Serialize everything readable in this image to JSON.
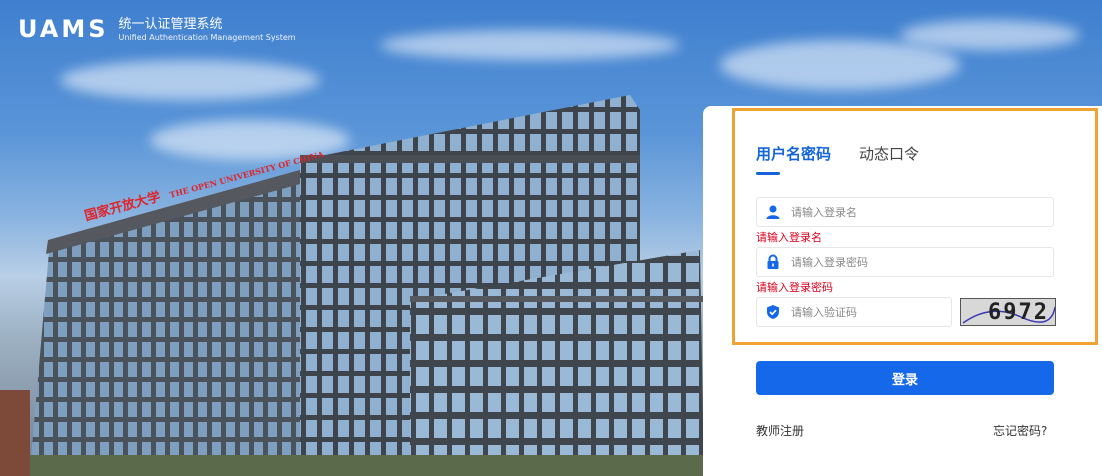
{
  "header": {
    "logo_main": "UAMS",
    "logo_cn": "统一认证管理系统",
    "logo_en": "Unified Authentication Management System"
  },
  "background": {
    "building_sign_cn": "国家开放大学",
    "building_sign_en": "THE OPEN UNIVERSITY OF CHINA"
  },
  "tabs": [
    {
      "label": "用户名密码",
      "active": true
    },
    {
      "label": "动态口令",
      "active": false
    }
  ],
  "form": {
    "username": {
      "placeholder": "请输入登录名",
      "value": "",
      "error": "请输入登录名"
    },
    "password": {
      "placeholder": "请输入登录密码",
      "value": "",
      "error": "请输入登录密码"
    },
    "captcha": {
      "placeholder": "请输入验证码",
      "value": "",
      "image_text": "6972"
    }
  },
  "login_button": "登录",
  "links": {
    "register": "教师注册",
    "forgot": "忘记密码?"
  },
  "colors": {
    "accent": "#1668ea",
    "error": "#d9001b",
    "highlight_border": "#f0a232"
  },
  "icons": {
    "user": "user-icon",
    "lock": "lock-icon",
    "shield": "shield-check-icon"
  }
}
